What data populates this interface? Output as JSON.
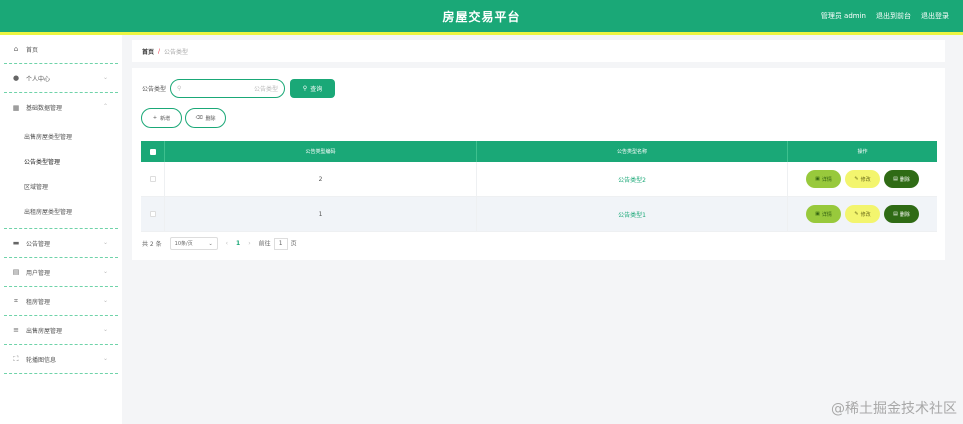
{
  "header": {
    "title": "房屋交易平台",
    "admin_label": "管理员 admin",
    "back_home": "退出到前台",
    "logout": "退出登录"
  },
  "sidebar": {
    "items": [
      {
        "label": "首页",
        "icon": "home-icon"
      },
      {
        "label": "个人中心",
        "icon": "user-icon"
      },
      {
        "label": "基础数据管理",
        "icon": "grid-icon"
      },
      {
        "label": "公告管理",
        "icon": "notice-icon"
      },
      {
        "label": "用户管理",
        "icon": "users-icon"
      },
      {
        "label": "租房管理",
        "icon": "crop-icon"
      },
      {
        "label": "出售房屋管理",
        "icon": "list-icon"
      },
      {
        "label": "轮播图信息",
        "icon": "fullscreen-icon"
      }
    ],
    "submenu": [
      "出售房屋类型管理",
      "公告类型管理",
      "区域管理",
      "出租房屋类型管理"
    ]
  },
  "breadcrumb": {
    "home": "首页",
    "separator": "/",
    "current": "公告类型"
  },
  "search": {
    "label": "公告类型",
    "placeholder": "公告类型",
    "button": "查询"
  },
  "actions": {
    "add": "新增",
    "delete": "删除"
  },
  "table": {
    "headers": [
      "公告类型编码",
      "公告类型名称",
      "操作"
    ],
    "rows": [
      {
        "code": "2",
        "name": "公告类型2"
      },
      {
        "code": "1",
        "name": "公告类型1"
      }
    ],
    "ops": {
      "detail": "详情",
      "edit": "修改",
      "delete": "删除"
    }
  },
  "pager": {
    "total": "共 2 条",
    "size": "10条/页",
    "page": "1",
    "goto": "前往",
    "goto_value": "1",
    "page_unit": "页"
  },
  "watermark": "@稀土掘金技术社区",
  "colors": {
    "primary": "#1aa877",
    "accent_bar": "#ecf542"
  }
}
